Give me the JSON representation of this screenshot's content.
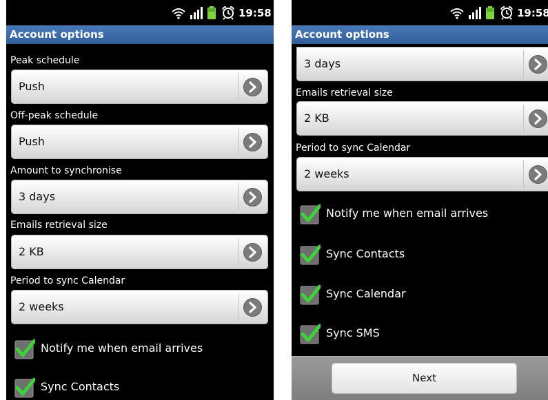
{
  "left_screen": {
    "status_bar": {
      "time": "19:58",
      "icons": [
        "wifi-icon",
        "signal-icon",
        "battery-icon",
        "alarm-icon"
      ]
    },
    "title": "Account options",
    "settings": [
      {
        "label": "Peak schedule",
        "value": "Push"
      },
      {
        "label": "Off-peak schedule",
        "value": "Push"
      },
      {
        "label": "Amount to synchronise",
        "value": "3 days"
      },
      {
        "label": "Emails retrieval size",
        "value": "2 KB"
      },
      {
        "label": "Period to sync Calendar",
        "value": "2 weeks"
      }
    ],
    "checkboxes": [
      {
        "label": "Notify me when email arrives",
        "checked": true
      },
      {
        "label": "Sync Contacts",
        "checked": true
      }
    ]
  },
  "right_screen": {
    "status_bar": {
      "time": "19:58",
      "icons": [
        "wifi-icon",
        "signal-icon",
        "battery-icon",
        "alarm-icon"
      ]
    },
    "title": "Account options",
    "settings": [
      {
        "label": "",
        "value": "3 days"
      },
      {
        "label": "Emails retrieval size",
        "value": "2 KB"
      },
      {
        "label": "Period to sync Calendar",
        "value": "2 weeks"
      }
    ],
    "checkboxes": [
      {
        "label": "Notify me when email arrives",
        "checked": true
      },
      {
        "label": "Sync Contacts",
        "checked": true
      },
      {
        "label": "Sync Calendar",
        "checked": true
      },
      {
        "label": "Sync SMS",
        "checked": true
      }
    ],
    "next_label": "Next"
  },
  "colors": {
    "title_bar": "#3f6fad",
    "check_green": "#3ed13a",
    "background": "#000000"
  }
}
